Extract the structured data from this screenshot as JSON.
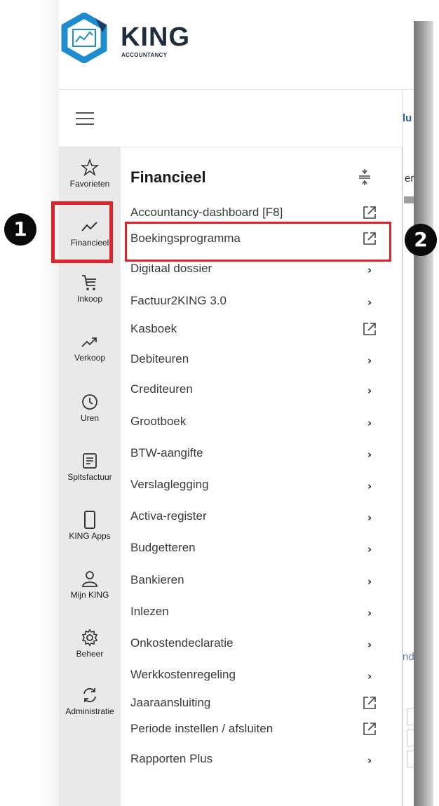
{
  "brand": {
    "name": "KING",
    "subtitle": "ACCOUNTANCY"
  },
  "colors": {
    "highlight": "#e0232b",
    "rail_bg": "#e9e9e9",
    "logo_blue": "#1f8ccf",
    "text": "#3a3a3a"
  },
  "background_fragments": {
    "top": "lu",
    "mid": "er",
    "lower": "nd"
  },
  "rail": [
    {
      "label": "Favorieten",
      "icon": "star-icon"
    },
    {
      "label": "Financieel",
      "icon": "trend-line-icon"
    },
    {
      "label": "Inkoop",
      "icon": "cart-icon"
    },
    {
      "label": "Verkoop",
      "icon": "trend-up-icon"
    },
    {
      "label": "Uren",
      "icon": "clock-icon"
    },
    {
      "label": "Spitsfactuur",
      "icon": "document-icon"
    },
    {
      "label": "KING Apps",
      "icon": "phone-icon"
    },
    {
      "label": "Mijn KING",
      "icon": "user-icon"
    },
    {
      "label": "Beheer",
      "icon": "gear-icon"
    },
    {
      "label": "Administratie",
      "icon": "sync-icon"
    }
  ],
  "panel": {
    "title": "Financieel",
    "items": [
      {
        "label": "Accountancy-dashboard [F8]",
        "trail": "external"
      },
      {
        "label": "Boekingsprogramma",
        "trail": "external"
      },
      {
        "label": "Digitaal dossier",
        "trail": "chevron"
      },
      {
        "label": "Factuur2KING 3.0",
        "trail": "chevron"
      },
      {
        "label": "Kasboek",
        "trail": "external"
      },
      {
        "label": "Debiteuren",
        "trail": "chevron"
      },
      {
        "label": "Crediteuren",
        "trail": "chevron"
      },
      {
        "label": "Grootboek",
        "trail": "chevron"
      },
      {
        "label": "BTW-aangifte",
        "trail": "chevron"
      },
      {
        "label": "Verslaglegging",
        "trail": "chevron"
      },
      {
        "label": "Activa-register",
        "trail": "chevron"
      },
      {
        "label": "Budgetteren",
        "trail": "chevron"
      },
      {
        "label": "Bankieren",
        "trail": "chevron"
      },
      {
        "label": "Inlezen",
        "trail": "chevron"
      },
      {
        "label": "Onkostendeclaratie",
        "trail": "chevron"
      },
      {
        "label": "Werkkostenregeling",
        "trail": "chevron"
      },
      {
        "label": "Jaaraansluiting",
        "trail": "external"
      },
      {
        "label": "Periode instellen / afsluiten",
        "trail": "external"
      },
      {
        "label": "Rapporten Plus",
        "trail": "chevron"
      }
    ]
  },
  "callouts": {
    "one": "1",
    "two": "2"
  },
  "chevron_glyph": "›"
}
